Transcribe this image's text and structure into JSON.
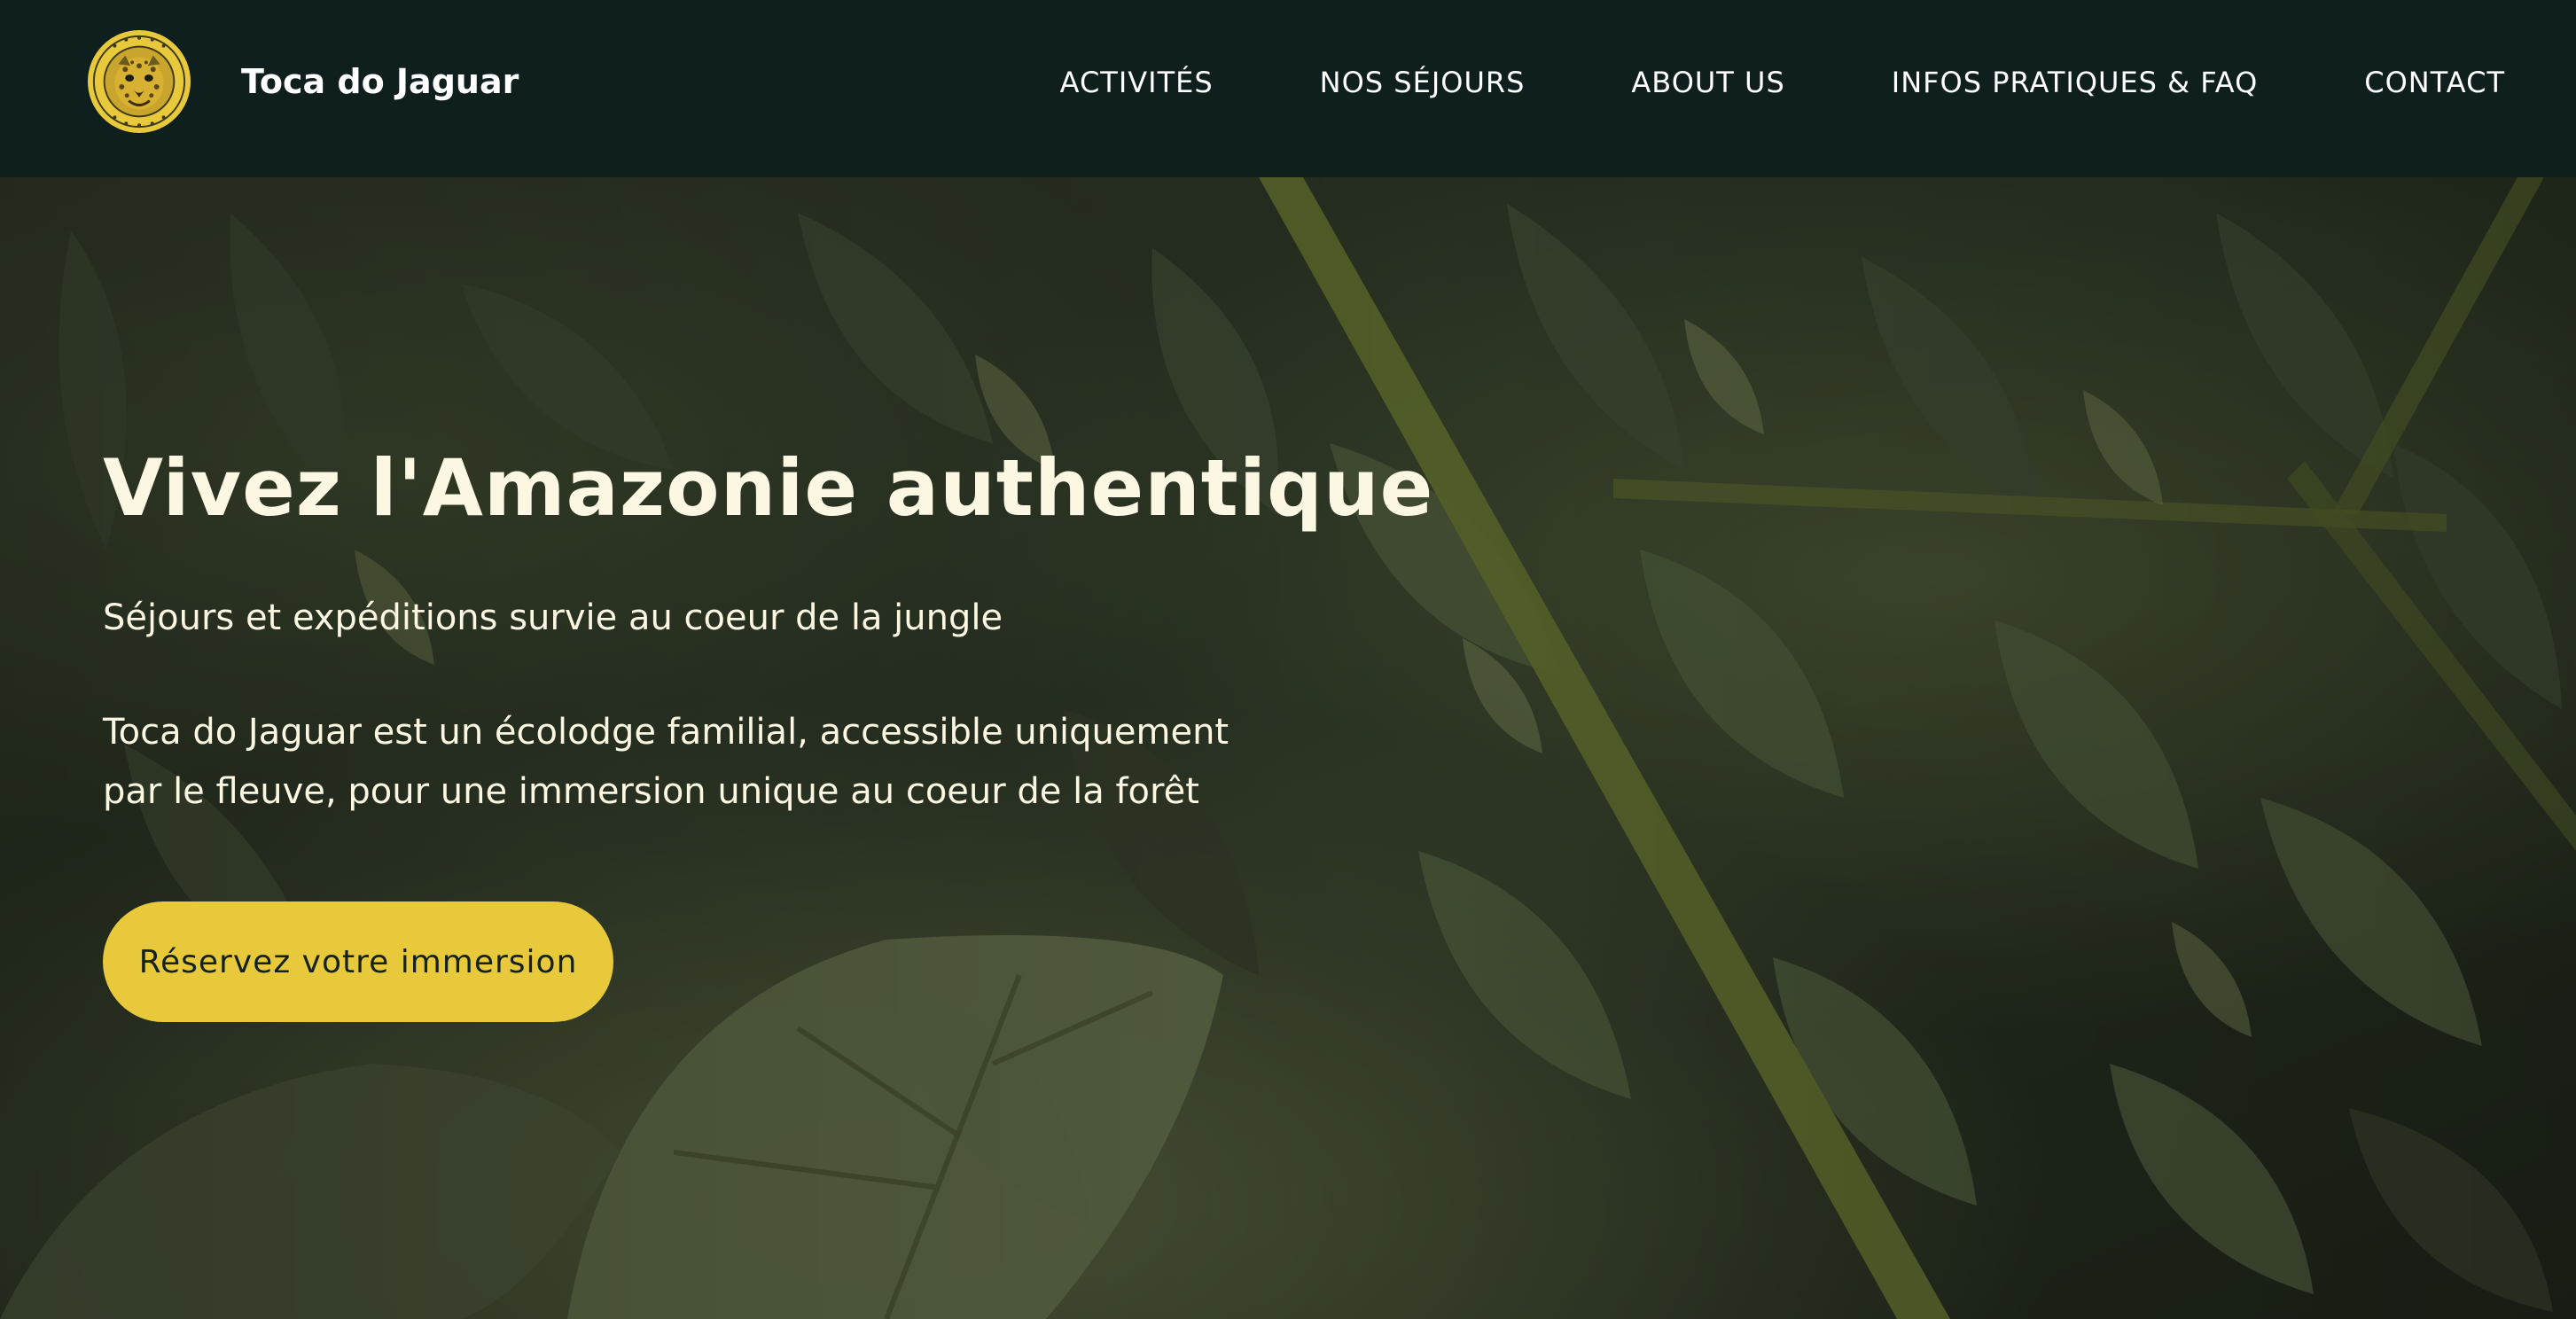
{
  "header": {
    "logo_icon": "jaguar-logo-icon",
    "brand_name": "Toca do Jaguar",
    "nav": [
      {
        "label": "ACTIVITÉS"
      },
      {
        "label": "NOS SÉJOURS"
      },
      {
        "label": "ABOUT US"
      },
      {
        "label": "INFOS PRATIQUES & FAQ"
      },
      {
        "label": "CONTACT"
      }
    ]
  },
  "hero": {
    "title": "Vivez l'Amazonie authentique",
    "subtitle": "Séjours et expéditions survie au coeur de la jungle",
    "description": "Toca do Jaguar est un écolodge familial, accessible uniquement par le fleuve, pour une immersion unique au coeur de la forêt",
    "cta_label": "Réservez votre immersion",
    "background": "jungle-foliage-image"
  },
  "colors": {
    "header_bg": "#0f1f1d",
    "accent_yellow": "#e8c93b",
    "hero_text": "#fbf7e2",
    "button_text": "#14221f"
  }
}
